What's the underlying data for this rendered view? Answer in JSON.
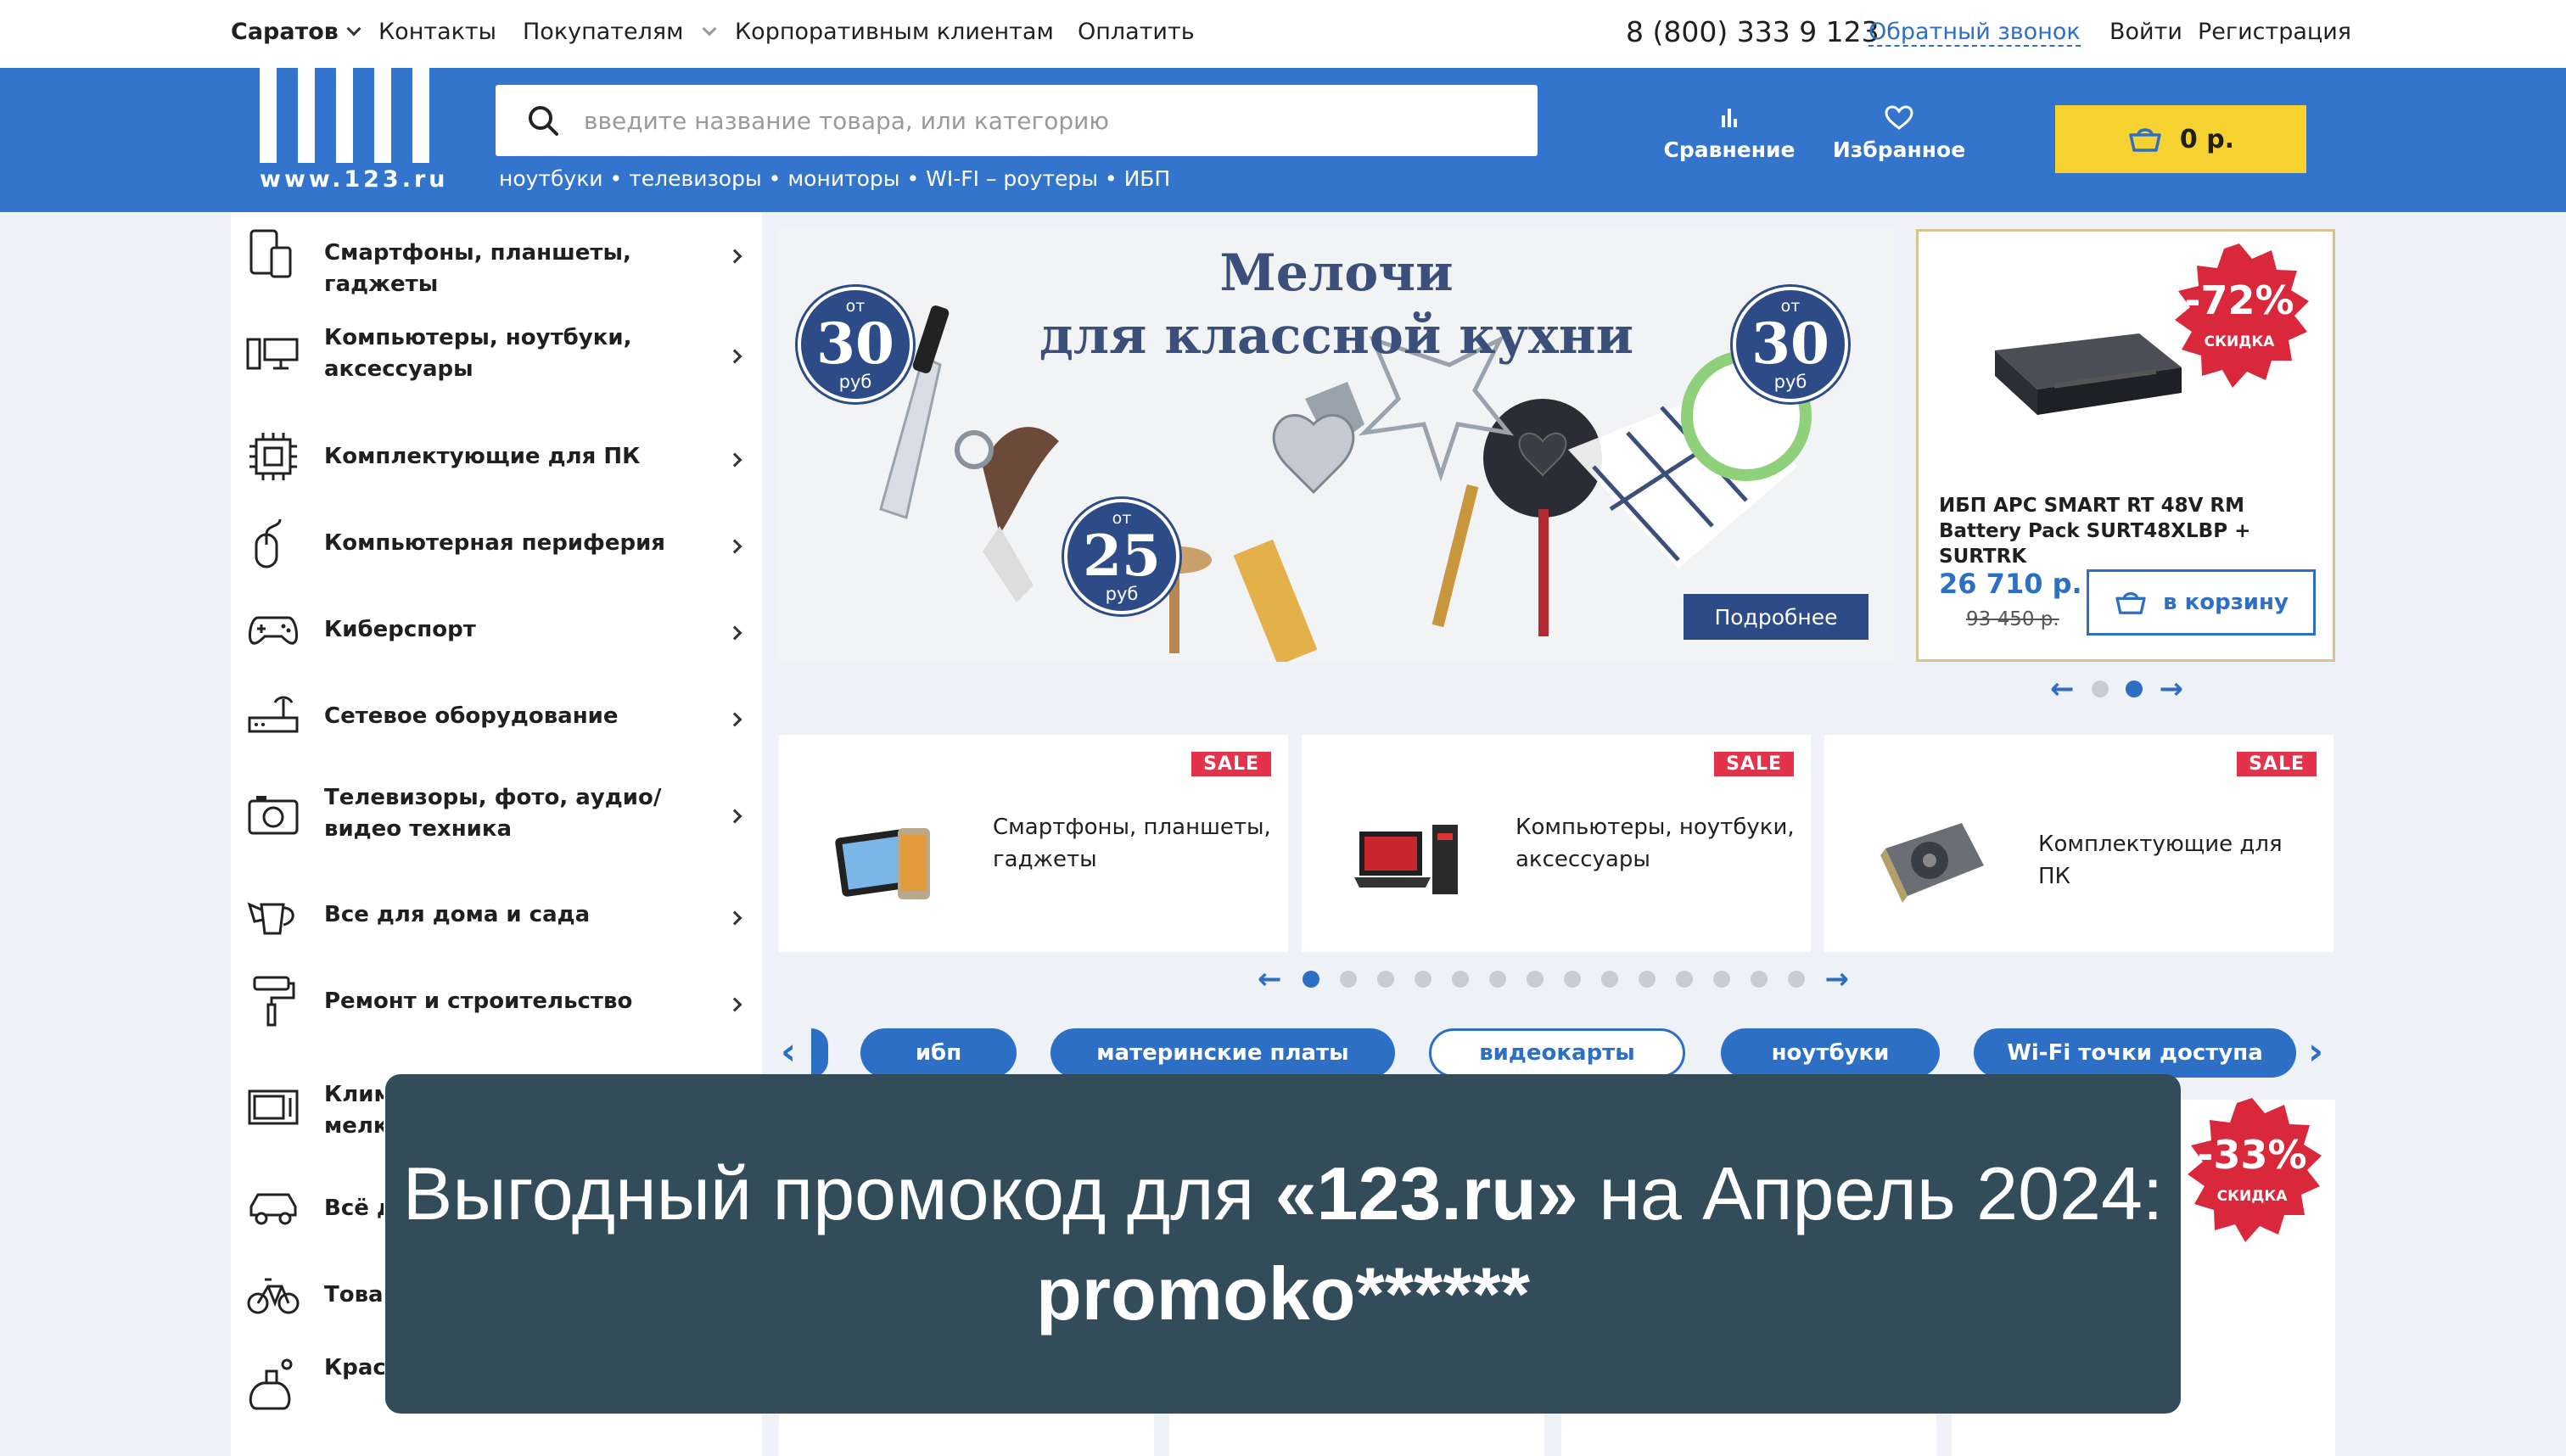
{
  "topbar": {
    "city": "Саратов",
    "links": [
      "Контакты",
      "Покупателям",
      "Корпоративным клиентам",
      "Оплатить"
    ],
    "phone": "8 (800) 333 9 123",
    "callback": "Обратный звонок",
    "login": "Войти",
    "register": "Регистрация"
  },
  "header": {
    "logo_url": "www.123.ru",
    "search_placeholder": "введите название товара, или категорию",
    "quick_links": "ноутбуки • телевизоры • мониторы • WI-FI – роутеры • ИБП",
    "compare": "Сравнение",
    "favorites": "Избранное",
    "cart": "0 р."
  },
  "sidebar": {
    "items": [
      {
        "label": "Смартфоны, планшеты, гаджеты",
        "icon": "smartphone-icon"
      },
      {
        "label": "Компьютеры, ноутбуки, аксессуары",
        "icon": "computer-icon"
      },
      {
        "label": "Комплектующие для ПК",
        "icon": "chip-icon"
      },
      {
        "label": "Компьютерная периферия",
        "icon": "mouse-icon"
      },
      {
        "label": "Киберспорт",
        "icon": "gamepad-icon"
      },
      {
        "label": "Сетевое оборудование",
        "icon": "router-icon"
      },
      {
        "label": "Телевизоры, фото, аудио/видео техника",
        "icon": "camera-icon"
      },
      {
        "label": "Все для дома и сада",
        "icon": "watering-can-icon"
      },
      {
        "label": "Ремонт и строительство",
        "icon": "paint-roller-icon"
      },
      {
        "label": "Клим… мелк…",
        "icon": "microwave-icon"
      },
      {
        "label": "Всё д…",
        "icon": "car-icon"
      },
      {
        "label": "Товар…",
        "icon": "bicycle-icon"
      },
      {
        "label": "Крас… бытовая химия",
        "icon": "cosmetics-icon"
      }
    ]
  },
  "banner": {
    "title_line1": "Мелочи",
    "title_line2": "для классной кухни",
    "badges": [
      {
        "small": "от",
        "num": "30",
        "unit": "руб"
      },
      {
        "small": "от",
        "num": "30",
        "unit": "руб"
      },
      {
        "small": "от",
        "num": "25",
        "unit": "руб"
      }
    ],
    "more": "Подробнее"
  },
  "product": {
    "discount": "-72%",
    "discount_label": "скидка",
    "title": "ИБП APC SMART RT 48V RM Battery Pack SURT48XLBP + SURTRK",
    "price": "26 710 р.",
    "old_price": "93 450 р.",
    "to_cart": "в корзину"
  },
  "sale_cards": [
    {
      "badge": "SALE",
      "label": "Смартфоны, планшеты, гаджеты"
    },
    {
      "badge": "SALE",
      "label": "Компьютеры, ноутбуки, аксессуары"
    },
    {
      "badge": "SALE",
      "label": "Комплектующие для ПК"
    }
  ],
  "tags": [
    "ибп",
    "материнские платы",
    "видеокарты",
    "ноутбуки",
    "Wi-Fi точки доступа"
  ],
  "second_discount": {
    "value": "-33%",
    "label": "скидка"
  },
  "promo": {
    "prefix": "Выгодный промокод для ",
    "brand": "«123.ru»",
    "middle": " на Апрель 2024: ",
    "code": "promoko******"
  },
  "colors": {
    "brand_blue": "#3374cc",
    "cart_yellow": "#f5d230",
    "sale_red": "#e2334a",
    "promo_bg": "#324c59"
  }
}
